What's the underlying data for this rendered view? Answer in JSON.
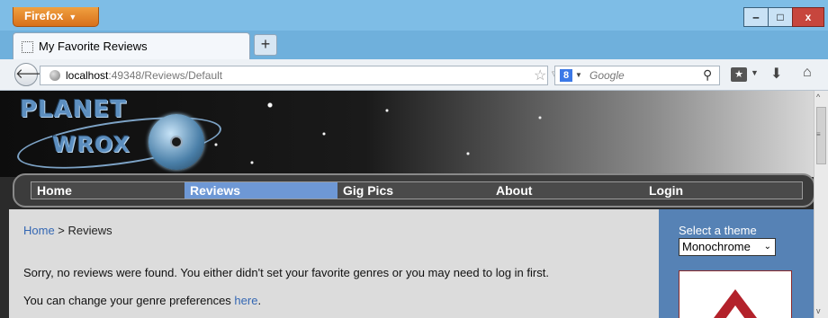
{
  "browser": {
    "menu_label": "Firefox",
    "tab_title": "My Favorite Reviews",
    "new_tab": "+",
    "url_host": "localhost",
    "url_rest": ":49348/Reviews/Default",
    "search_placeholder": "Google",
    "window_min": "‒",
    "window_max": "□",
    "window_close": "x"
  },
  "site": {
    "logo_line1": "PLANET",
    "logo_line2": "WROX",
    "menu": [
      "Home",
      "Reviews",
      "Gig Pics",
      "About",
      "Login"
    ],
    "active_menu": "Reviews"
  },
  "breadcrumb": {
    "home": "Home",
    "separator": " > ",
    "current": "Reviews"
  },
  "content": {
    "message": "Sorry, no reviews were found. You either didn't set your favorite genres or you may need to log in first.",
    "change_prefix": "You can change your genre preferences ",
    "change_link": "here",
    "change_suffix": "."
  },
  "sidebar": {
    "theme_label": "Select a theme",
    "theme_value": "Monochrome"
  },
  "colors": {
    "menu_active": "#6e98d5",
    "sidebar_bg": "#5682b5",
    "link": "#3467b3"
  }
}
